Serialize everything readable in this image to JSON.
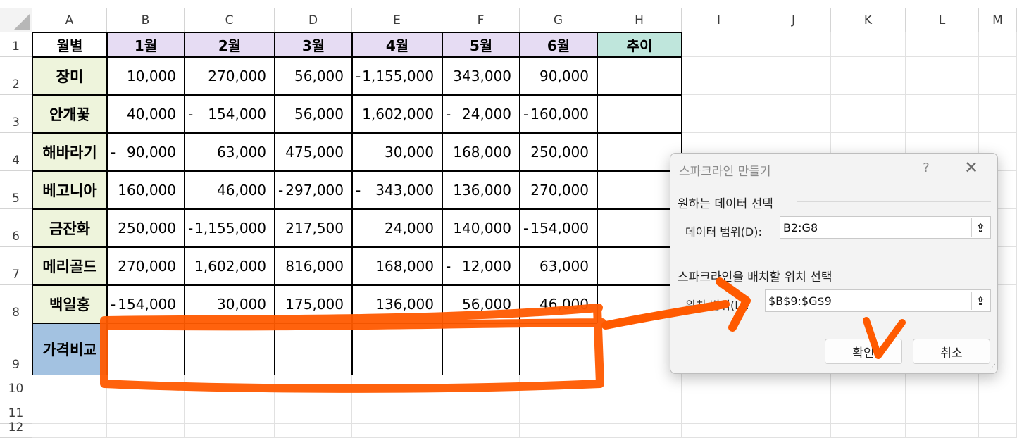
{
  "columns": [
    "A",
    "B",
    "C",
    "D",
    "E",
    "F",
    "G",
    "H",
    "I",
    "J",
    "K",
    "L",
    "M"
  ],
  "rows": [
    "1",
    "2",
    "3",
    "4",
    "5",
    "6",
    "7",
    "8",
    "9",
    "10",
    "11",
    "12"
  ],
  "header": {
    "label": "월별",
    "months": [
      "1월",
      "2월",
      "3월",
      "4월",
      "5월",
      "6월"
    ],
    "trend": "추이"
  },
  "data_rows": [
    {
      "name": "장미",
      "values": [
        "10,000",
        "270,000",
        "56,000",
        "- 1,155,000",
        "343,000",
        "90,000"
      ]
    },
    {
      "name": "안개꽃",
      "values": [
        "40,000",
        "- 154,000",
        "56,000",
        "1,602,000",
        "- 24,000",
        "- 160,000"
      ]
    },
    {
      "name": "해바라기",
      "values": [
        "- 90,000",
        "63,000",
        "475,000",
        "30,000",
        "168,000",
        "250,000"
      ]
    },
    {
      "name": "베고니아",
      "values": [
        "160,000",
        "46,000",
        "- 297,000",
        "- 343,000",
        "136,000",
        "270,000"
      ]
    },
    {
      "name": "금잔화",
      "values": [
        "250,000",
        "- 1,155,000",
        "217,500",
        "24,000",
        "140,000",
        "- 154,000"
      ]
    },
    {
      "name": "메리골드",
      "values": [
        "270,000",
        "1,602,000",
        "816,000",
        "168,000",
        "- 12,000",
        "63,000"
      ]
    },
    {
      "name": "백일홍",
      "values": [
        "- 154,000",
        "30,000",
        "175,000",
        "136,000",
        "56,000",
        "46,000"
      ]
    }
  ],
  "row9_label": "가격비교",
  "dialog": {
    "title": "스파크라인 만들기",
    "help": "?",
    "close": "✕",
    "section1": "원하는 데이터 선택",
    "data_range_label": "데이터 범위(D):",
    "data_range_value": "B2:G8",
    "section2": "스파크라인을 배치할 위치 선택",
    "location_label": "위치 범위(L):",
    "location_value": "$B$9:$G$9",
    "ok": "확인",
    "cancel": "취소",
    "collapse_icon": "range-collapse-icon"
  },
  "annotation_color": "#ff5a00"
}
